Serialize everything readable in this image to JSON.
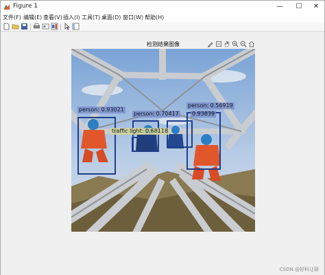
{
  "window": {
    "title": "Figure 1",
    "controls": {
      "minimize": "—",
      "maximize": "☐",
      "close": "✕"
    }
  },
  "menu": [
    {
      "label": "文件(F)"
    },
    {
      "label": "编辑(E)"
    },
    {
      "label": "查看(V)"
    },
    {
      "label": "插入(I)"
    },
    {
      "label": "工具(T)"
    },
    {
      "label": "桌面(D)"
    },
    {
      "label": "窗口(W)"
    },
    {
      "label": "帮助(H)"
    }
  ],
  "toolbar": [
    "new-file-icon",
    "open-folder-icon",
    "save-icon",
    "print-icon",
    "link-icon",
    "insert-colorbar-icon",
    "pointer-icon",
    "property-editor-icon"
  ],
  "axes": {
    "title": "检测结果图像",
    "tools": [
      "brush-icon",
      "export-icon",
      "pan-hand-icon",
      "zoom-in-icon",
      "zoom-out-icon",
      "home-icon"
    ]
  },
  "detections": [
    {
      "label": "person: 0.93021"
    },
    {
      "label": "person: 0.70417"
    },
    {
      "label": "0.93839"
    },
    {
      "label": "person: 0.56919"
    },
    {
      "label": "traffic light: 0.68118"
    }
  ],
  "watermark": "CSDN @好科让研"
}
